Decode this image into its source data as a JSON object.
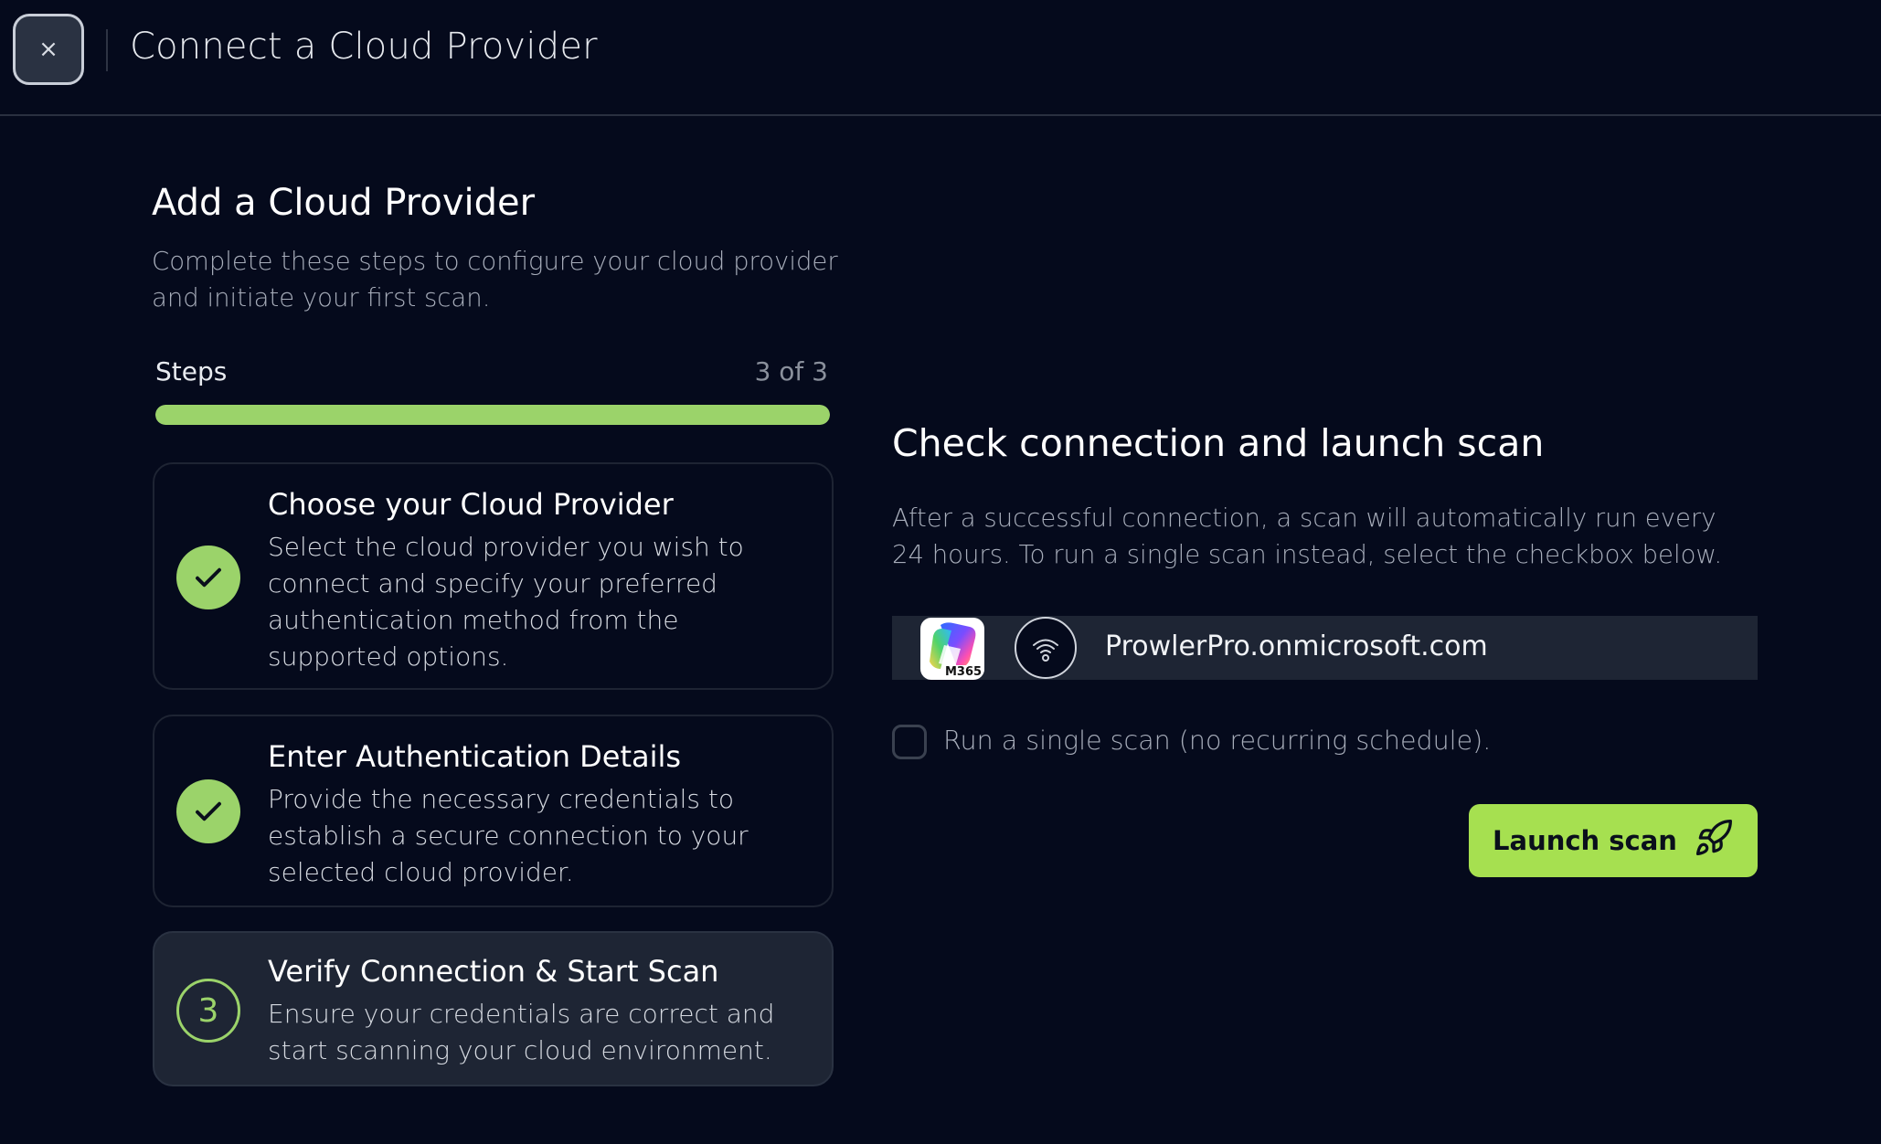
{
  "header": {
    "close_label": "×",
    "title": "Connect a Cloud Provider"
  },
  "sidebar": {
    "title": "Add a Cloud Provider",
    "description": "Complete these steps to configure your cloud provider and initiate your first scan.",
    "steps_label": "Steps",
    "steps_count": "3 of 3",
    "progress_fraction": 1.0,
    "steps": [
      {
        "title": "Choose your Cloud Provider",
        "description": "Select the cloud provider you wish to connect and specify your preferred authentication method from the supported options.",
        "status": "complete"
      },
      {
        "title": "Enter Authentication Details",
        "description": "Provide the necessary credentials to establish a secure connection to your selected cloud provider.",
        "status": "complete"
      },
      {
        "number": "3",
        "title": "Verify Connection & Start Scan",
        "description": "Ensure your credentials are correct and start scanning your cloud environment.",
        "status": "active"
      }
    ]
  },
  "main": {
    "title": "Check connection and launch scan",
    "description": "After a successful connection, a scan will automatically run every 24 hours. To run a single scan instead, select the checkbox below.",
    "provider": {
      "logo_label": "M365",
      "logo_icon": "microsoft-365-icon",
      "status_icon": "wifi-connection-icon",
      "alias": "ProwlerPro.onmicrosoft.com"
    },
    "single_scan_label": "Run a single scan (no recurring schedule).",
    "single_scan_checked": false,
    "launch_label": "Launch scan",
    "launch_icon": "rocket-icon"
  },
  "colors": {
    "background": "#050a1c",
    "accent": "#9bd36a",
    "button": "#a6e050"
  }
}
